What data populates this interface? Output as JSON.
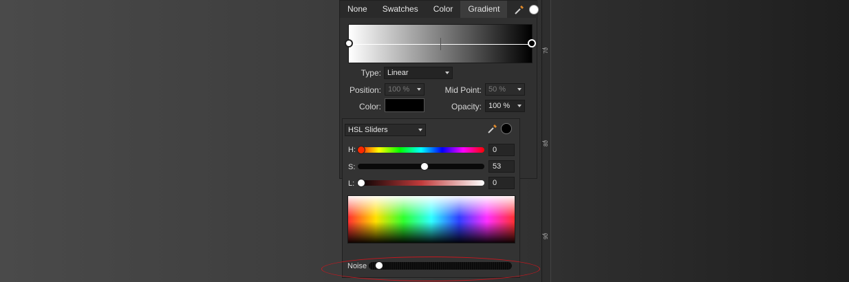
{
  "tabs": [
    {
      "label": "None"
    },
    {
      "label": "Swatches"
    },
    {
      "label": "Color"
    },
    {
      "label": "Gradient",
      "active": true
    }
  ],
  "gradient": {
    "type_label": "Type:",
    "type_value": "Linear",
    "position_label": "Position:",
    "position_value": "100 %",
    "midpoint_label": "Mid Point:",
    "midpoint_value": "50 %",
    "color_label": "Color:",
    "color_value": "#000000",
    "opacity_label": "Opacity:",
    "opacity_value": "100 %",
    "start_color": "#ffffff",
    "end_color": "#000000"
  },
  "picker": {
    "mode": "HSL Sliders",
    "h_label": "H:",
    "h_value": "0",
    "s_label": "S:",
    "s_value": "53",
    "l_label": "L:",
    "l_value": "0",
    "noise_label": "Noise",
    "noise_level": 0.07
  },
  "ruler": {
    "labels": [
      "70",
      "80",
      "90"
    ]
  },
  "icons": {
    "eyedropper": "eyedropper-icon",
    "current_fill": "fill-swatch-icon"
  },
  "colors": {
    "annotation": "#c8171f",
    "panel_bg": "#303030",
    "tab_active": "#3c3c3c"
  }
}
